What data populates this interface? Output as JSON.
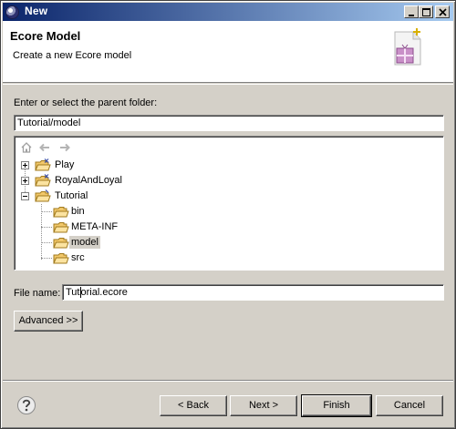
{
  "window": {
    "title": "New",
    "app_icon": "eclipse-icon",
    "controls": [
      "minimize-icon",
      "maximize-icon",
      "close-icon"
    ]
  },
  "header": {
    "title": "Ecore Model",
    "description": "Create a new Ecore model",
    "wizard_icon": "new-ecore-file-wizard-icon"
  },
  "parent_folder": {
    "label": "Enter or select the parent folder:",
    "value": "Tutorial/model"
  },
  "tree_nav": [
    "home-icon",
    "back-arrow-icon",
    "forward-arrow-icon"
  ],
  "tree": [
    {
      "label": "Play",
      "level": 0,
      "expander": "plus",
      "icon": "project-folder-icon"
    },
    {
      "label": "RoyalAndLoyal",
      "level": 0,
      "expander": "plus",
      "icon": "project-folder-icon"
    },
    {
      "label": "Tutorial",
      "level": 0,
      "expander": "minus",
      "icon": "open-project-folder-icon"
    },
    {
      "label": "bin",
      "level": 1,
      "icon": "folder-icon"
    },
    {
      "label": "META-INF",
      "level": 1,
      "icon": "folder-icon"
    },
    {
      "label": "model",
      "level": 1,
      "icon": "folder-icon",
      "selected": true
    },
    {
      "label": "src",
      "level": 1,
      "icon": "folder-icon"
    }
  ],
  "file_name": {
    "label": "File name:",
    "value_before_cursor": "Tut",
    "value_after_cursor": "orial.ecore"
  },
  "advanced_button": "Advanced >>",
  "footer": {
    "help_icon": "help-icon",
    "back": "< Back",
    "next": "Next >",
    "finish": "Finish",
    "cancel": "Cancel"
  },
  "colors": {
    "titlebar_start": "#0a246a",
    "titlebar_end": "#a6caf0",
    "dialog_face": "#d4d0c8",
    "folder": "#f2c86a"
  }
}
